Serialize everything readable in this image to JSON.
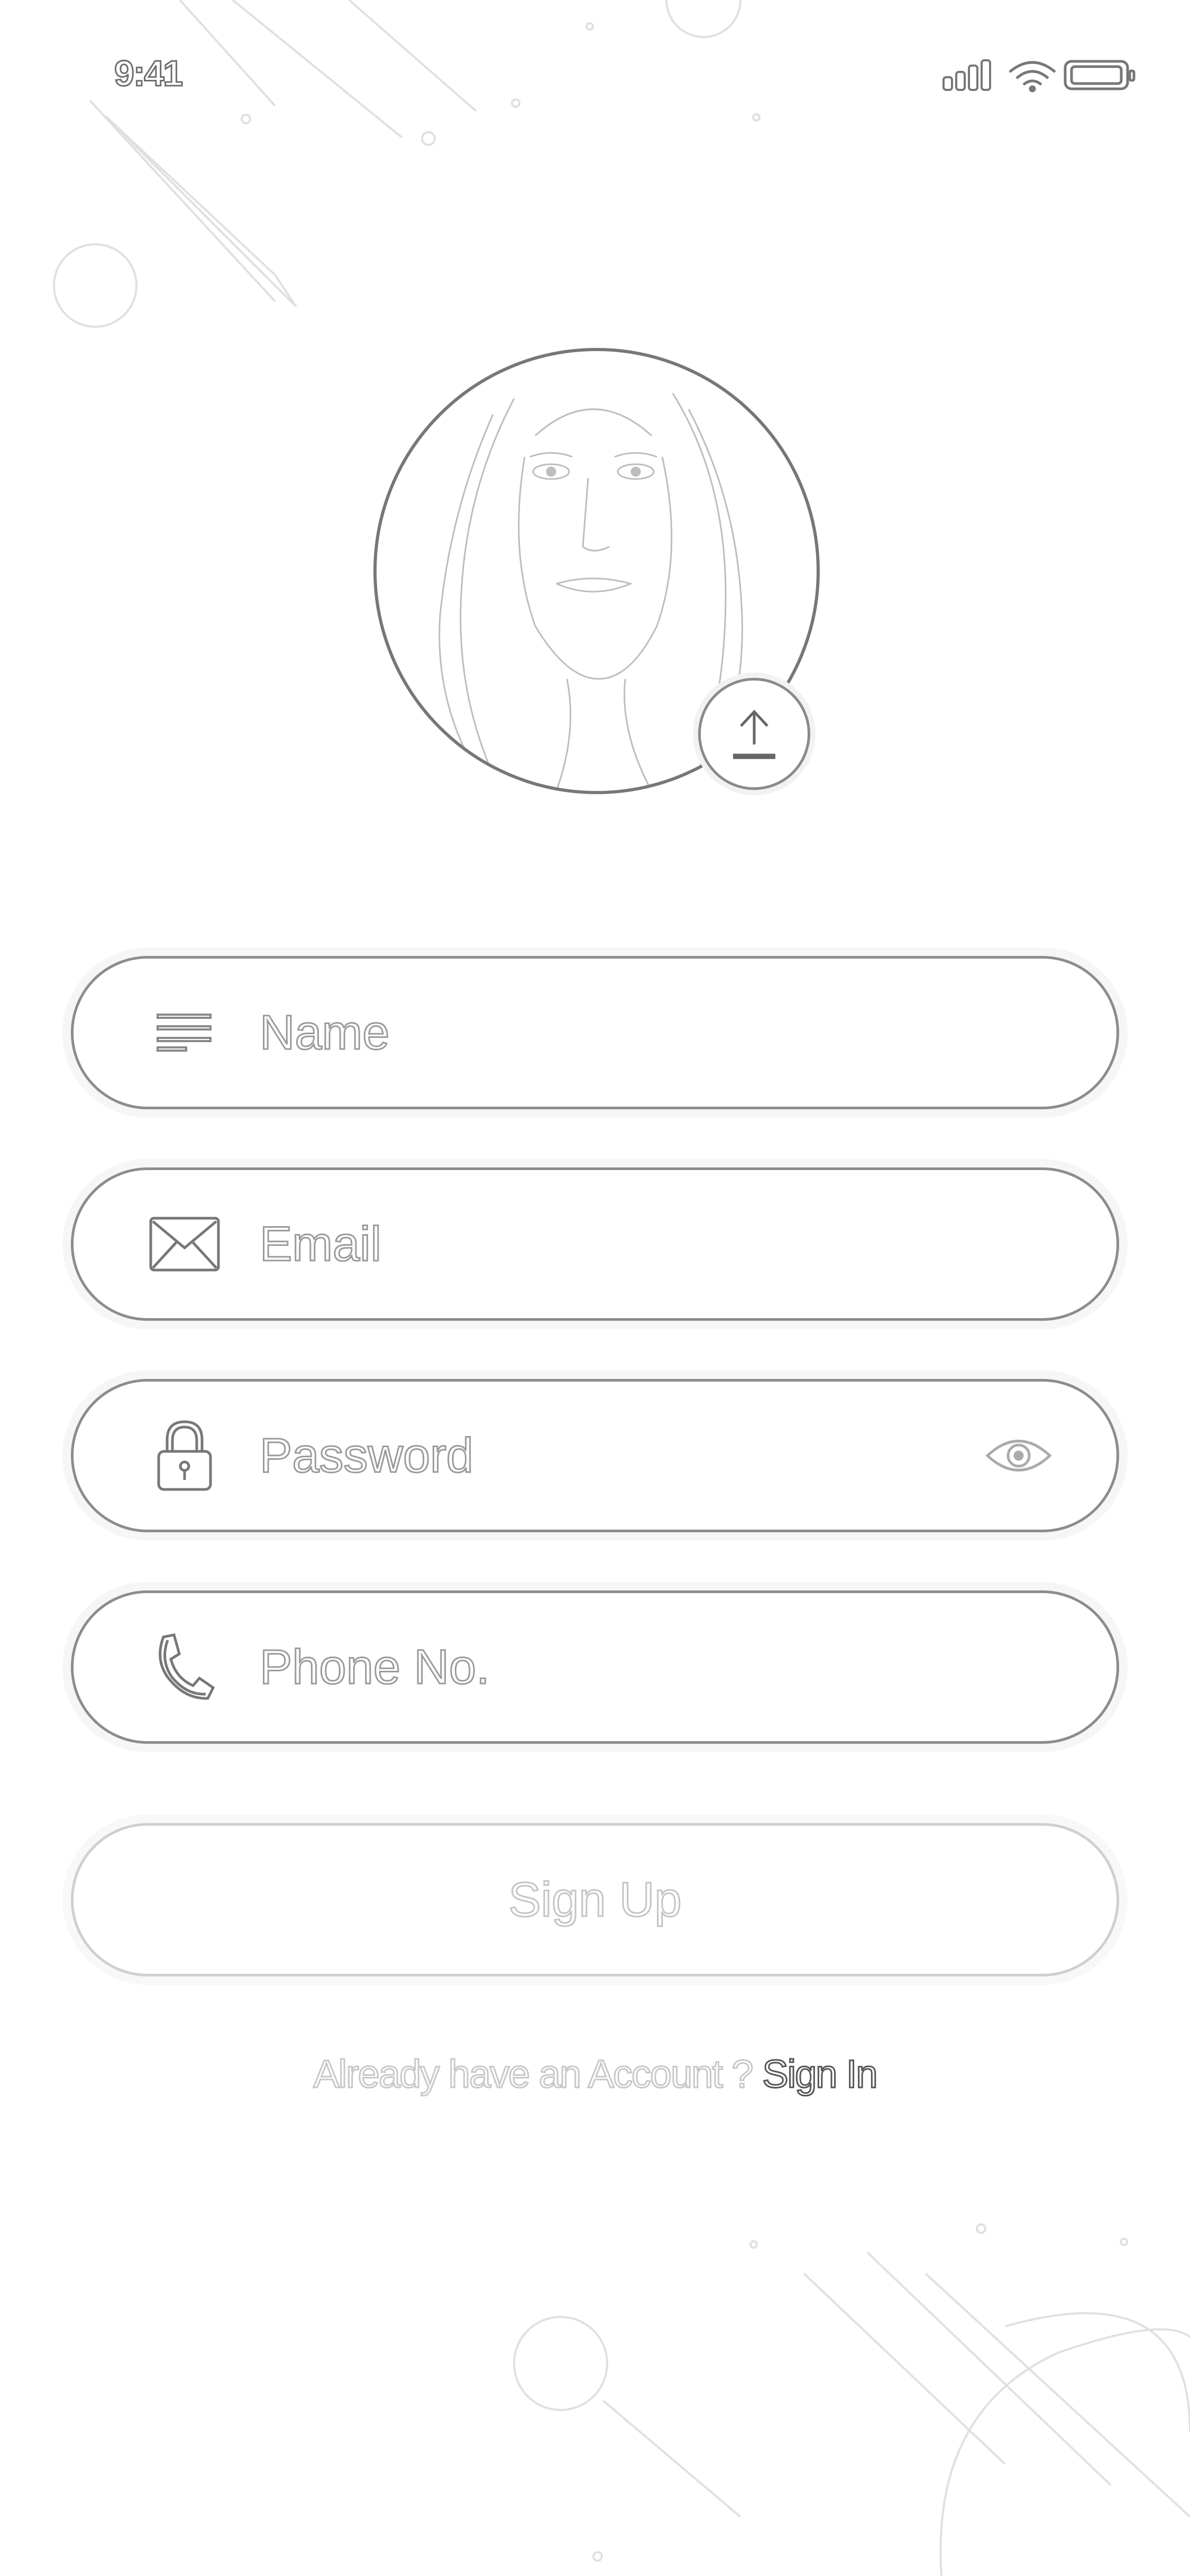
{
  "status_bar": {
    "time": "9:41",
    "icons": [
      "signal-icon",
      "wifi-icon",
      "battery-icon"
    ]
  },
  "profile": {
    "avatar_label": "profile-photo",
    "upload_icon": "upload-icon"
  },
  "form": {
    "name": {
      "placeholder": "Name",
      "icon": "lines-icon"
    },
    "email": {
      "placeholder": "Email",
      "icon": "envelope-icon"
    },
    "password": {
      "placeholder": "Password",
      "icon": "lock-icon",
      "toggle_icon": "eye-icon"
    },
    "phone": {
      "placeholder": "Phone No.",
      "icon": "phone-icon"
    }
  },
  "actions": {
    "signup_label": "Sign Up",
    "signin_prompt": "Already have an Account ? ",
    "signin_link": "Sign In"
  },
  "colors": {
    "background": "#ffffff",
    "outline": "#8c8c8c"
  }
}
